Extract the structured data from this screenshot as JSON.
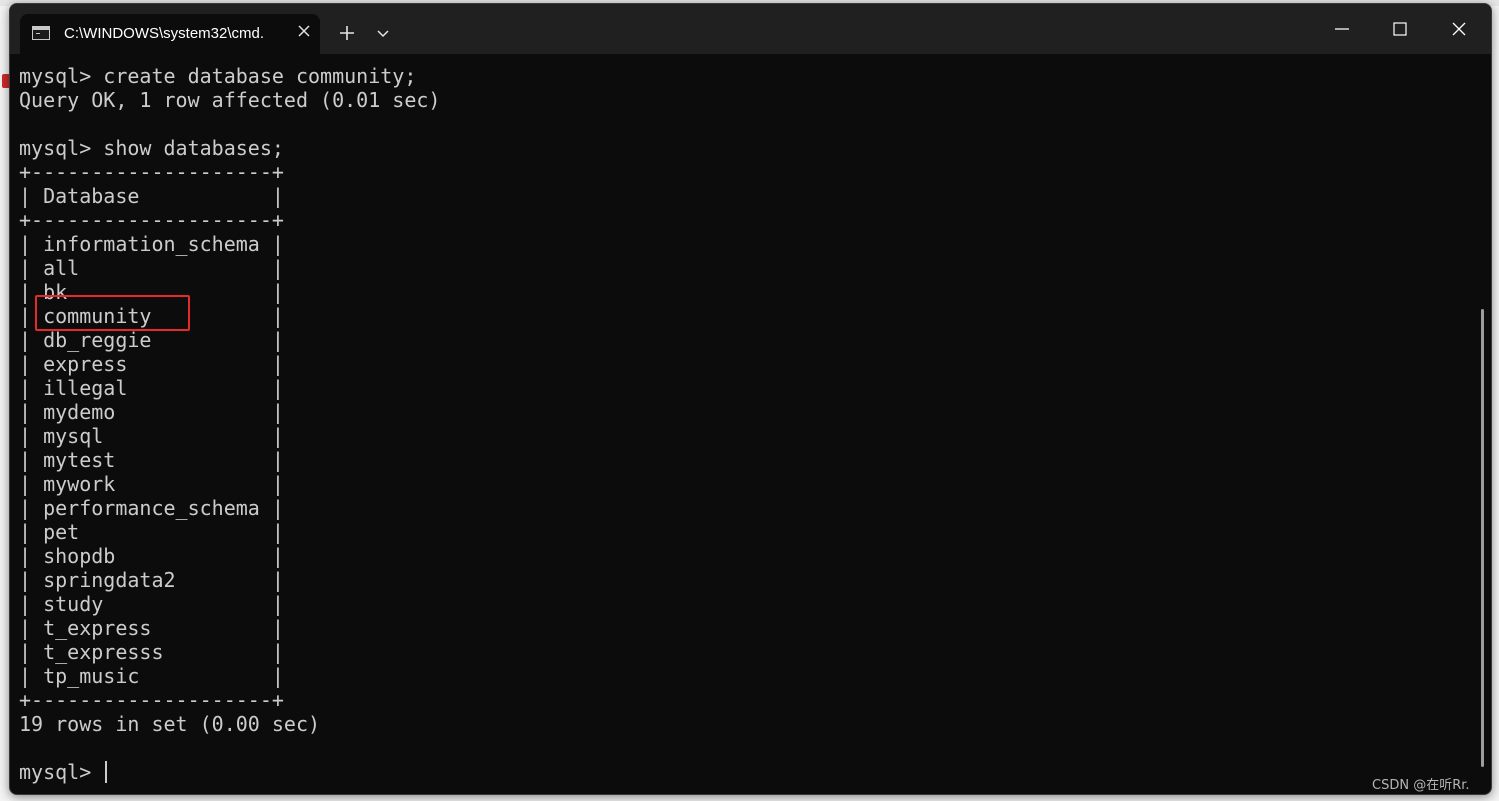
{
  "window": {
    "tab_title": "C:\\WINDOWS\\system32\\cmd.",
    "tab_icon": "terminal-icon",
    "close_tab_icon": "close-icon",
    "new_tab_icon": "plus-icon",
    "dropdown_icon": "chevron-down-icon",
    "controls": [
      "minimize-icon",
      "maximize-icon",
      "close-icon"
    ]
  },
  "terminal": {
    "lines": [
      "mysql> create database community;",
      "Query OK, 1 row affected (0.01 sec)",
      "",
      "mysql> show databases;",
      "+--------------------+",
      "| Database           |",
      "+--------------------+",
      "| information_schema |",
      "| all                |",
      "| bk                 |",
      "| community          |",
      "| db_reggie          |",
      "| express            |",
      "| illegal            |",
      "| mydemo             |",
      "| mysql              |",
      "| mytest             |",
      "| mywork             |",
      "| performance_schema |",
      "| pet                |",
      "| shopdb             |",
      "| springdata2        |",
      "| study              |",
      "| t_express          |",
      "| t_expresss         |",
      "| tp_music           |",
      "+--------------------+",
      "19 rows in set (0.00 sec)",
      ""
    ],
    "prompt": "mysql> ",
    "highlighted_entry": "community"
  },
  "watermark": "CSDN @在听Rr.",
  "colors": {
    "terminal_bg": "#0c0c0c",
    "text": "#cccccc",
    "titlebar": "#202020",
    "highlight_box": "#e52a2a"
  }
}
